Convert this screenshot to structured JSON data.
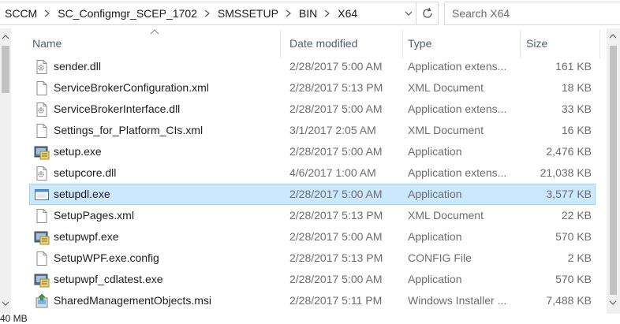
{
  "address_bar": {
    "crumbs": [
      "SCCM",
      "SC_Configmgr_SCEP_1702",
      "SMSSETUP",
      "BIN",
      "X64"
    ]
  },
  "search": {
    "placeholder": "Search X64"
  },
  "columns": {
    "name": "Name",
    "date": "Date modified",
    "type": "Type",
    "size": "Size"
  },
  "sort": {
    "column": "name",
    "direction": "ascending"
  },
  "files": [
    {
      "name": "sender.dll",
      "date": "2/28/2017 5:00 AM",
      "type": "Application extens...",
      "size": "161 KB",
      "icon": "dll-icon"
    },
    {
      "name": "ServiceBrokerConfiguration.xml",
      "date": "2/28/2017 5:13 PM",
      "type": "XML Document",
      "size": "18 KB",
      "icon": "xml-file-icon"
    },
    {
      "name": "ServiceBrokerInterface.dll",
      "date": "2/28/2017 5:00 AM",
      "type": "Application extens...",
      "size": "33 KB",
      "icon": "dll-icon"
    },
    {
      "name": "Settings_for_Platform_CIs.xml",
      "date": "3/1/2017 2:05 AM",
      "type": "XML Document",
      "size": "16 KB",
      "icon": "xml-file-icon"
    },
    {
      "name": "setup.exe",
      "date": "2/28/2017 5:00 AM",
      "type": "Application",
      "size": "2,476 KB",
      "icon": "setup-exe-icon"
    },
    {
      "name": "setupcore.dll",
      "date": "4/6/2017 1:00 AM",
      "type": "Application extens...",
      "size": "21,038 KB",
      "icon": "dll-icon"
    },
    {
      "name": "setupdl.exe",
      "date": "2/28/2017 5:00 AM",
      "type": "Application",
      "size": "3,577 KB",
      "icon": "app-window-icon",
      "selected": true
    },
    {
      "name": "SetupPages.xml",
      "date": "2/28/2017 5:13 PM",
      "type": "XML Document",
      "size": "22 KB",
      "icon": "xml-file-icon"
    },
    {
      "name": "setupwpf.exe",
      "date": "2/28/2017 5:00 AM",
      "type": "Application",
      "size": "570 KB",
      "icon": "setup-exe-icon"
    },
    {
      "name": "SetupWPF.exe.config",
      "date": "2/28/2017 5:13 PM",
      "type": "CONFIG File",
      "size": "2 KB",
      "icon": "config-file-icon"
    },
    {
      "name": "setupwpf_cdlatest.exe",
      "date": "2/28/2017 5:00 AM",
      "type": "Application",
      "size": "570 KB",
      "icon": "setup-exe-icon"
    },
    {
      "name": "SharedManagementObjects.msi",
      "date": "2/28/2017 5:11 PM",
      "type": "Windows Installer ...",
      "size": "7,488 KB",
      "icon": "msi-installer-icon"
    }
  ],
  "status_bar": {
    "fragment": "40 MB"
  },
  "colors": {
    "selection_bg": "#cce8ff",
    "selection_border": "#99d1ff",
    "header_text": "#4c607a",
    "secondary_text": "#6d6d6d"
  }
}
